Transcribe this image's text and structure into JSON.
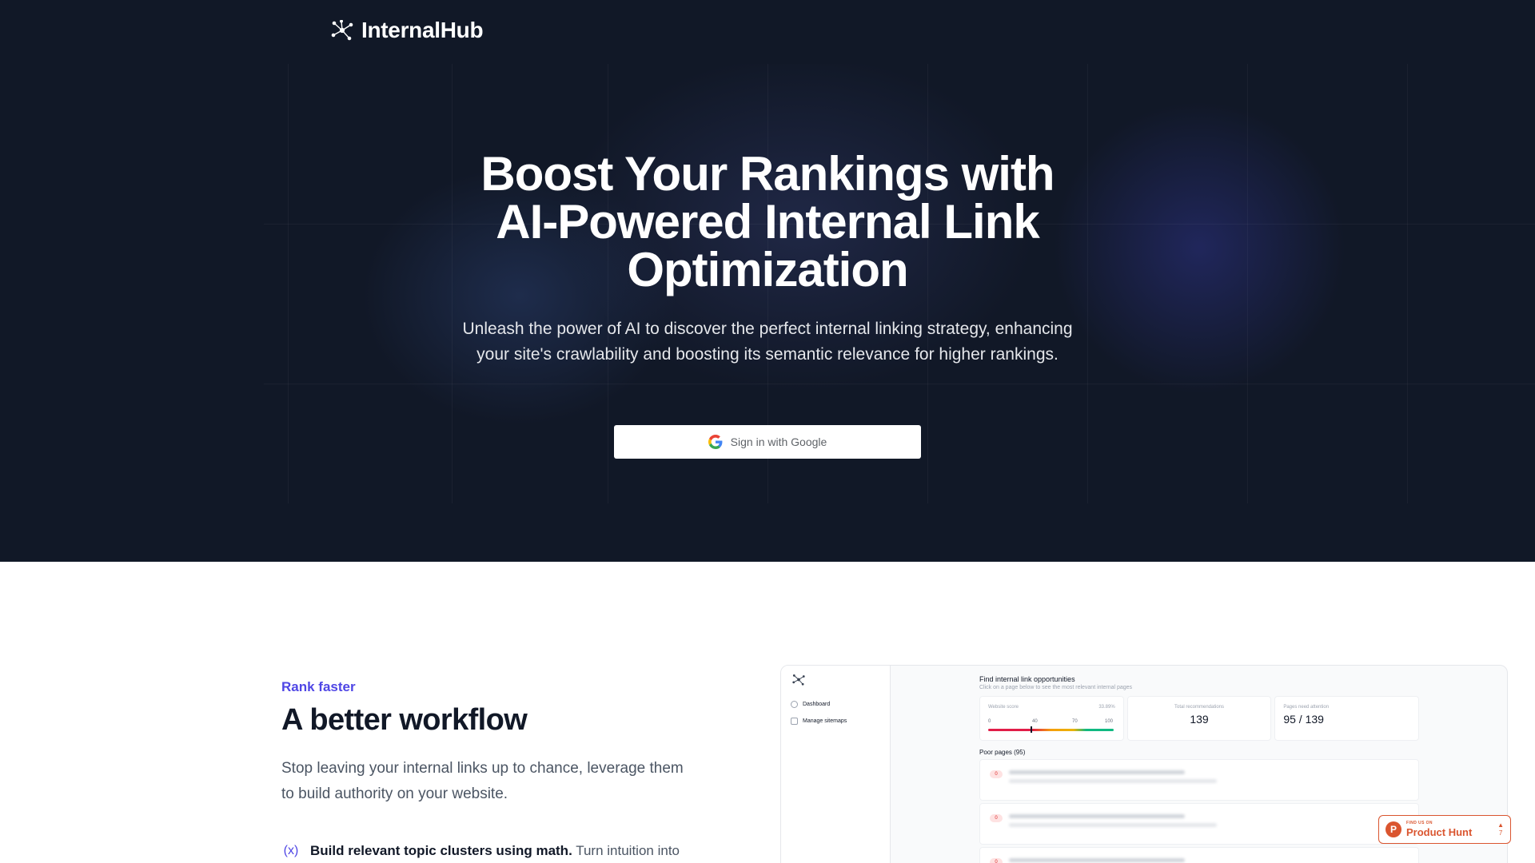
{
  "brand": {
    "name": "InternalHub"
  },
  "hero": {
    "title_line1": "Boost Your Rankings with",
    "title_line2": "AI-Powered Internal Link",
    "title_line3": "Optimization",
    "subtitle": "Unleash the power of AI to discover the perfect internal linking strategy, enhancing your site's crawlability and boosting its semantic relevance for higher rankings.",
    "cta_label": "Sign in with Google"
  },
  "feature": {
    "eyebrow": "Rank faster",
    "title": "A better workflow",
    "description": "Stop leaving your internal links up to chance, leverage them to build authority on your website.",
    "item_bold": "Build relevant topic clusters using math.",
    "item_text": "Turn intuition into"
  },
  "mockup": {
    "nav": [
      "Dashboard",
      "Manage sitemaps"
    ],
    "heading": "Find internal link opportunities",
    "subheading": "Click on a page below to see the most relevant internal pages",
    "score": {
      "label": "Website score",
      "percent": "33.89%",
      "ticks": [
        "0",
        "40",
        "70",
        "100"
      ]
    },
    "recommendations": {
      "label": "Total recommendations",
      "value": "139"
    },
    "attention": {
      "label": "Pages need attention",
      "value": "95 / 139"
    },
    "poor_pages_title": "Poor pages (95)",
    "row_badge": "0"
  },
  "product_hunt": {
    "small": "FIND US ON",
    "big": "Product Hunt",
    "votes": "7"
  },
  "colors": {
    "hero_bg": "#111827",
    "accent": "#4f46e5",
    "ph": "#da552f"
  }
}
